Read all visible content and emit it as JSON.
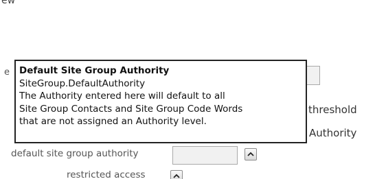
{
  "top_fragment": "ew",
  "peek_letter": "e",
  "right_column": {
    "line1": "threshold",
    "line2": "Authority"
  },
  "form": {
    "default_site_group_authority_label": "default site group authority",
    "default_site_group_authority_value": "",
    "restricted_access_label": "restricted access",
    "stepper_icon": "chevron-up-icon"
  },
  "tooltip": {
    "title": "Default Site Group Authority",
    "field_key": "SiteGroup.DefaultAuthority",
    "description_lines": [
      "The Authority entered here will default to all",
      "Site Group Contacts and Site Group Code Words",
      "that are not assigned an Authority level."
    ]
  },
  "colors": {
    "tooltip_border": "#222222",
    "field_background": "#f1f1f1",
    "field_border": "#a9a9a9"
  }
}
